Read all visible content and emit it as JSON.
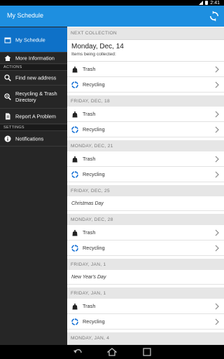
{
  "status_bar": {
    "time": "2:41"
  },
  "action_bar": {
    "title": "My Schedule",
    "refresh_icon": "refresh-icon"
  },
  "sidebar": {
    "items_top": [
      {
        "label": "My Schedule",
        "icon": "calendar-icon",
        "active": true
      },
      {
        "label": "More Information",
        "icon": "home-icon",
        "active": false
      }
    ],
    "actions_header": "ACTIONS",
    "actions": [
      {
        "label": "Find new address",
        "icon": "search-icon"
      },
      {
        "label": "Recycling & Trash Directory",
        "icon": "magnify-icon"
      },
      {
        "label": "Report A Problem",
        "icon": "report-icon"
      }
    ],
    "settings_header": "SETTINGS",
    "settings": [
      {
        "label": "Notifications",
        "icon": "info-icon"
      }
    ]
  },
  "schedule": {
    "next_header": "NEXT COLLECTION",
    "next_date": "Monday, Dec, 14",
    "next_sub": "Items being collected:",
    "trash_label": "Trash",
    "recycling_label": "Recycling",
    "sections": [
      {
        "header": "FRIDAY, DEC, 18"
      },
      {
        "header": "MONDAY, DEC, 21"
      },
      {
        "header": "FRIDAY, DEC, 25",
        "holiday": "Christmas Day"
      },
      {
        "header": "MONDAY, DEC, 28"
      },
      {
        "header": "FRIDAY, JAN, 1",
        "holiday": "New Year's Day"
      },
      {
        "header": "FRIDAY, JAN, 1"
      },
      {
        "header": "MONDAY, JAN, 4"
      }
    ]
  },
  "colors": {
    "action_bar": "#1e8fe0",
    "sidebar_active": "#0e71c8",
    "recycle": "#1a73d6"
  }
}
